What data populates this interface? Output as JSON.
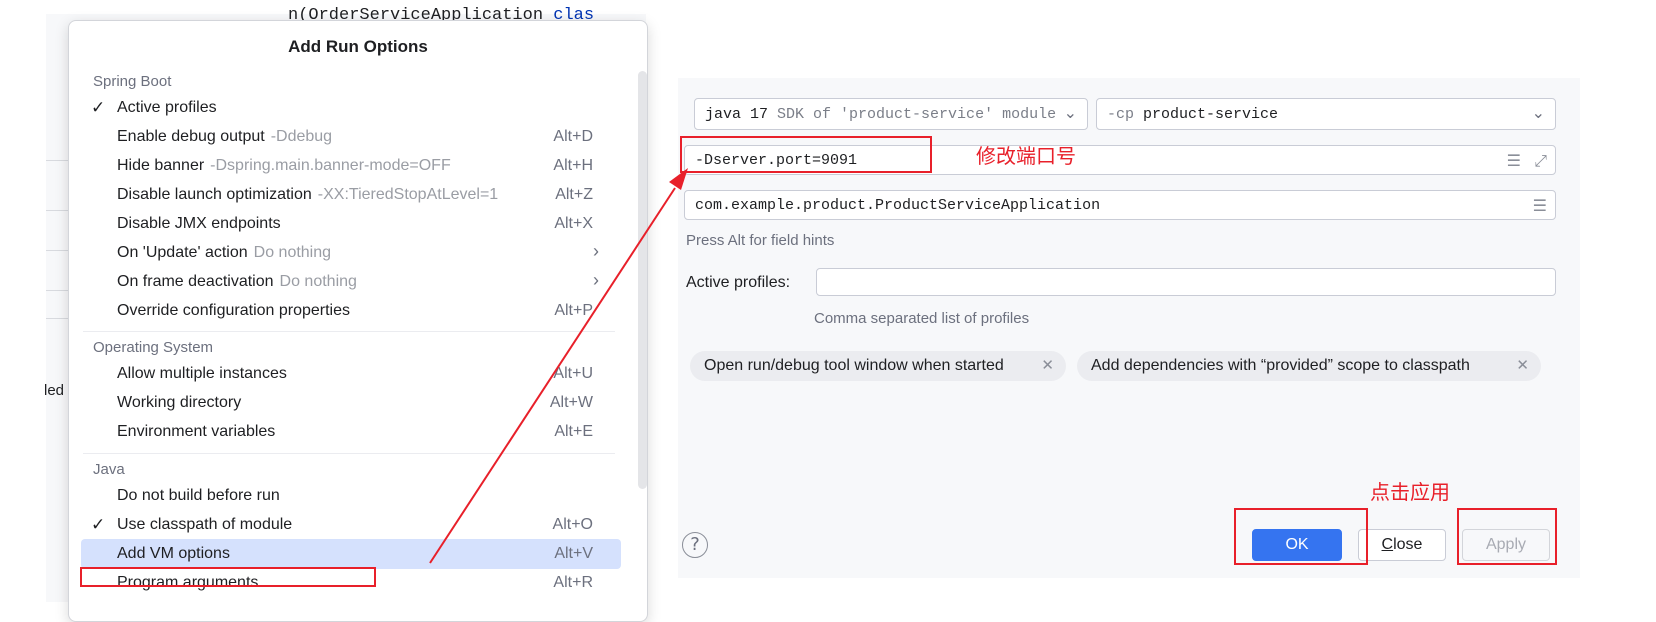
{
  "background": {
    "code_text": "n(OrderServiceApplication",
    "code_keyword": "clas",
    "side_fragment": "led"
  },
  "popup": {
    "title": "Add Run Options",
    "sections": {
      "spring_boot": "Spring Boot",
      "operating_system": "Operating System",
      "java": "Java"
    },
    "items": [
      {
        "label": "Active profiles",
        "hint": "",
        "key": "",
        "checked": "✓"
      },
      {
        "label": "Enable debug output",
        "hint": "-Ddebug",
        "key": "Alt+D",
        "checked": ""
      },
      {
        "label": "Hide banner",
        "hint": "-Dspring.main.banner-mode=OFF",
        "key": "Alt+H",
        "checked": ""
      },
      {
        "label": "Disable launch optimization",
        "hint": "-XX:TieredStopAtLevel=1",
        "key": "Alt+Z",
        "checked": ""
      },
      {
        "label": "Disable JMX endpoints",
        "hint": "",
        "key": "Alt+X",
        "checked": ""
      },
      {
        "label": "On 'Update' action",
        "hint": "Do nothing",
        "key": "",
        "checked": ""
      },
      {
        "label": "On frame deactivation",
        "hint": "Do nothing",
        "key": "",
        "checked": ""
      },
      {
        "label": "Override configuration properties",
        "hint": "",
        "key": "Alt+P",
        "checked": ""
      },
      {
        "label": "Allow multiple instances",
        "hint": "",
        "key": "Alt+U",
        "checked": ""
      },
      {
        "label": "Working directory",
        "hint": "",
        "key": "Alt+W",
        "checked": ""
      },
      {
        "label": "Environment variables",
        "hint": "",
        "key": "Alt+E",
        "checked": ""
      },
      {
        "label": "Do not build before run",
        "hint": "",
        "key": "",
        "checked": ""
      },
      {
        "label": "Use classpath of module",
        "hint": "",
        "key": "Alt+O",
        "checked": "✓"
      },
      {
        "label": "Add VM options",
        "hint": "",
        "key": "Alt+V",
        "checked": ""
      },
      {
        "label": "Program arguments",
        "hint": "",
        "key": "Alt+R",
        "checked": ""
      }
    ]
  },
  "annotations": {
    "modify_port": "修改端口号",
    "click_apply": "点击应用"
  },
  "panel": {
    "jdk": {
      "name": "java 17",
      "desc": "SDK of 'product-service' module"
    },
    "classpath": {
      "flag": "-cp",
      "module": "product-service"
    },
    "vm_options": "-Dserver.port=9091",
    "main_class": "com.example.product.ProductServiceApplication",
    "field_hint": "Press Alt for field hints",
    "active_profiles_label": "Active profiles:",
    "active_profiles_value": "",
    "active_profiles_hint": "Comma separated list of profiles",
    "chips": [
      "Open run/debug tool window when started",
      "Add dependencies with “provided” scope to classpath"
    ],
    "buttons": {
      "help": "?",
      "ok": "OK",
      "close_mnemonic": "C",
      "close_rest": "lose",
      "apply": "Apply"
    }
  },
  "icons": {
    "checkmark": "check-icon",
    "submenu": "chevron-right-icon",
    "dropdown": "chevron-down-icon",
    "expand": "expand-icon",
    "browse": "list-icon",
    "remove": "close-icon",
    "help": "help-icon"
  },
  "colors": {
    "accent": "#3574f0",
    "annotation_red": "#e8202a",
    "selection": "#d5e1fd"
  }
}
